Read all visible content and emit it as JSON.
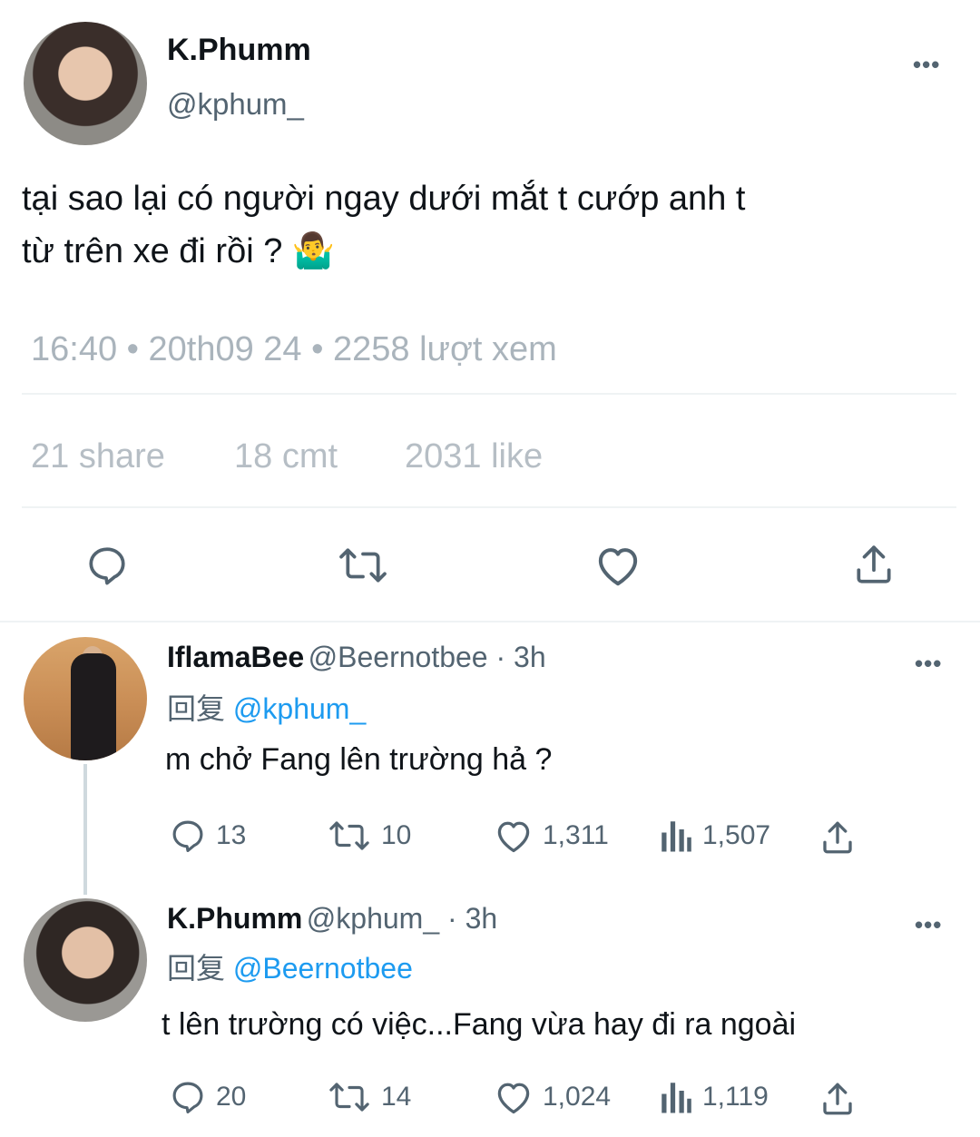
{
  "main_tweet": {
    "author_name": "K.Phumm",
    "author_handle": "@kphum_",
    "more": "•••",
    "text_line1": "tại sao lại có người ngay dưới mắt t cướp anh t",
    "text_line2": "từ trên xe đi rồi ? 🤷‍♂️",
    "meta": "16:40 • 20th09 24 • 2258 lượt xem",
    "stats": {
      "shares": "21 share",
      "comments": "18 cmt",
      "likes": "2031 like"
    },
    "actions": [
      "reply-icon",
      "retweet-icon",
      "like-icon",
      "share-icon"
    ]
  },
  "replies": [
    {
      "author_name": "IflamaBee",
      "author_handle": "@Beernotbee · 3h",
      "reply_prefix": "回复",
      "reply_to": "@kphum_",
      "text": "m chở Fang lên trường hả ?",
      "counts": {
        "replies": "13",
        "retweets": "10",
        "likes": "1,311",
        "views": "1,507"
      },
      "more": "•••"
    },
    {
      "author_name": "K.Phumm",
      "author_handle": "@kphum_ · 3h",
      "reply_prefix": "回复",
      "reply_to": "@Beernotbee",
      "text": "t lên trường có việc...Fang vừa hay đi ra ngoài",
      "counts": {
        "replies": "20",
        "retweets": "14",
        "likes": "1,024",
        "views": "1,119"
      },
      "more": "•••"
    }
  ],
  "colors": {
    "link": "#1d9bf0",
    "muted": "#536471",
    "divider": "#eff3f4"
  }
}
